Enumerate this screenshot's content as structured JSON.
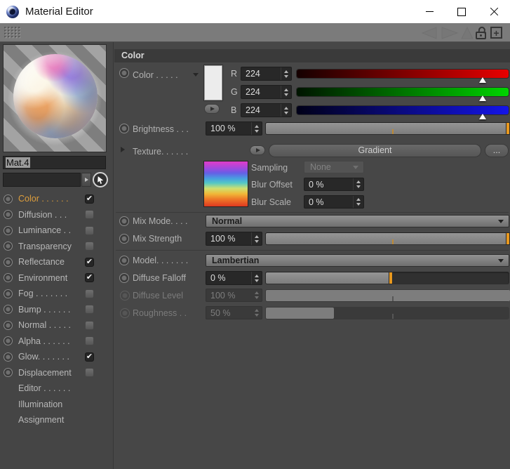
{
  "window": {
    "title": "Material Editor"
  },
  "sidebar": {
    "material_name": "Mat.4",
    "channels": [
      {
        "label": "Color . . . . . .",
        "checked": true,
        "active": true,
        "type": "channel"
      },
      {
        "label": "Diffusion . . .",
        "checked": false,
        "active": false,
        "type": "channel"
      },
      {
        "label": "Luminance . .",
        "checked": false,
        "active": false,
        "type": "channel"
      },
      {
        "label": "Transparency",
        "checked": false,
        "active": false,
        "type": "channel"
      },
      {
        "label": "Reflectance",
        "checked": true,
        "active": false,
        "type": "channel"
      },
      {
        "label": "Environment",
        "checked": true,
        "active": false,
        "type": "channel"
      },
      {
        "label": "Fog . . . . . . .",
        "checked": false,
        "active": false,
        "type": "channel"
      },
      {
        "label": "Bump . . . . . .",
        "checked": false,
        "active": false,
        "type": "channel"
      },
      {
        "label": "Normal . . . . .",
        "checked": false,
        "active": false,
        "type": "channel"
      },
      {
        "label": "Alpha . . . . . .",
        "checked": false,
        "active": false,
        "type": "channel"
      },
      {
        "label": "Glow. . . . . . .",
        "checked": true,
        "active": false,
        "type": "channel"
      },
      {
        "label": "Displacement",
        "checked": false,
        "active": false,
        "type": "channel"
      },
      {
        "label": "Editor . . . . . .",
        "type": "page"
      },
      {
        "label": "Illumination",
        "type": "page"
      },
      {
        "label": "Assignment",
        "type": "page"
      }
    ]
  },
  "panel": {
    "section_header": "Color",
    "color": {
      "label": "Color . . . . .",
      "r": "224",
      "g": "224",
      "b": "224",
      "slider_pos": "87.8%"
    },
    "brightness": {
      "label": "Brightness . . .",
      "value": "100 %",
      "fill": "100%",
      "tick": "52%"
    },
    "texture": {
      "label": "Texture. . . . . .",
      "button_label": "Gradient",
      "more_label": "..."
    },
    "sampling": {
      "label": "Sampling",
      "value": "None"
    },
    "blur_offset": {
      "label": "Blur Offset",
      "value": "0 %"
    },
    "blur_scale": {
      "label": "Blur Scale",
      "value": "0 %"
    },
    "mix_mode": {
      "label": "Mix Mode. . . .",
      "value": "Normal"
    },
    "mix_strength": {
      "label": "Mix Strength",
      "value": "100 %",
      "fill": "100%",
      "tick": "52%"
    },
    "model": {
      "label": "Model. . . . . . .",
      "value": "Lambertian"
    },
    "diffuse_falloff": {
      "label": "Diffuse Falloff",
      "value": "0 %",
      "fill": "52%",
      "handle": "52%",
      "tick": "52%"
    },
    "diffuse_level": {
      "label": "Diffuse Level",
      "value": "100 %",
      "fill": "100%",
      "tick": "52%"
    },
    "roughness": {
      "label": "Roughness . .",
      "value": "50 %",
      "fill": "28%",
      "tick": "52%"
    }
  },
  "colors": {
    "accent_orange": "#e8981e",
    "active_channel_text": "#de9e3c",
    "red_slider_end": "#e80000",
    "green_slider_end": "#00d400",
    "blue_slider_end": "#1414e8",
    "swatch": "#ececec"
  }
}
